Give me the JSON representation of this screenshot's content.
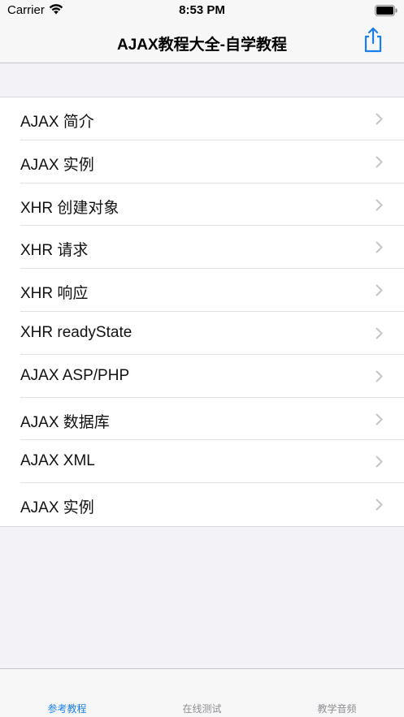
{
  "status_bar": {
    "carrier": "Carrier",
    "time": "8:53 PM"
  },
  "nav": {
    "title": "AJAX教程大全-自学教程",
    "share_icon": "share-icon",
    "accent_color": "#1a7ee8"
  },
  "list": {
    "items": [
      {
        "label": "AJAX 简介"
      },
      {
        "label": "AJAX 实例"
      },
      {
        "label": "XHR 创建对象"
      },
      {
        "label": "XHR 请求"
      },
      {
        "label": "XHR 响应"
      },
      {
        "label": "XHR readyState"
      },
      {
        "label": "AJAX ASP/PHP"
      },
      {
        "label": "AJAX 数据库"
      },
      {
        "label": "AJAX XML"
      },
      {
        "label": "AJAX 实例"
      }
    ]
  },
  "tabs": [
    {
      "label": "参考教程",
      "active": true
    },
    {
      "label": "在线测试",
      "active": false
    },
    {
      "label": "教学音频",
      "active": false
    }
  ]
}
